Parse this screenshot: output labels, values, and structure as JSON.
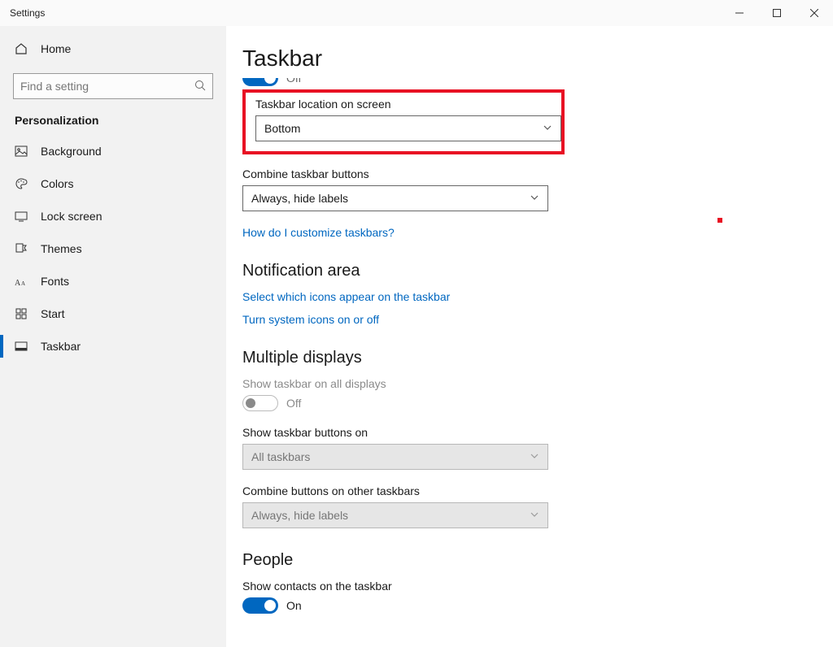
{
  "window": {
    "title": "Settings"
  },
  "sidebar": {
    "home": "Home",
    "search_placeholder": "Find a setting",
    "category": "Personalization",
    "items": [
      {
        "label": "Background"
      },
      {
        "label": "Colors"
      },
      {
        "label": "Lock screen"
      },
      {
        "label": "Themes"
      },
      {
        "label": "Fonts"
      },
      {
        "label": "Start"
      },
      {
        "label": "Taskbar"
      }
    ]
  },
  "page": {
    "title": "Taskbar",
    "partial_toggle_label": "Off",
    "location": {
      "label": "Taskbar location on screen",
      "value": "Bottom"
    },
    "combine": {
      "label": "Combine taskbar buttons",
      "value": "Always, hide labels"
    },
    "help_link": "How do I customize taskbars?",
    "notification": {
      "heading": "Notification area",
      "link1": "Select which icons appear on the taskbar",
      "link2": "Turn system icons on or off"
    },
    "multiple": {
      "heading": "Multiple displays",
      "show_all_label": "Show taskbar on all displays",
      "show_all_state": "Off",
      "buttons_on_label": "Show taskbar buttons on",
      "buttons_on_value": "All taskbars",
      "combine_other_label": "Combine buttons on other taskbars",
      "combine_other_value": "Always, hide labels"
    },
    "people": {
      "heading": "People",
      "show_contacts_label": "Show contacts on the taskbar",
      "show_contacts_state": "On"
    }
  }
}
